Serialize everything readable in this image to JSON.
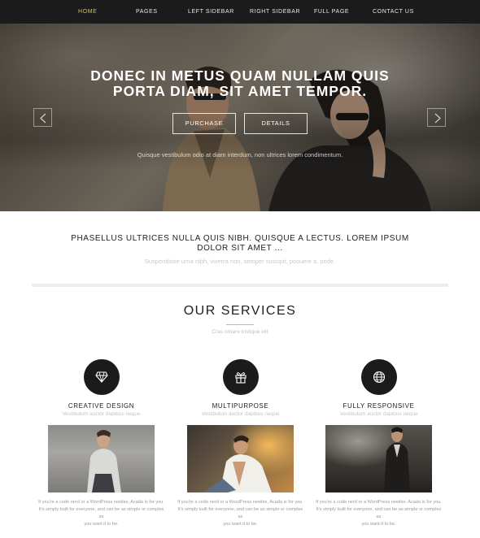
{
  "nav": {
    "items": [
      {
        "label": "HOME",
        "active": true
      },
      {
        "label": "PAGES",
        "active": false
      },
      {
        "label": "LEFT SIDEBAR",
        "active": false
      },
      {
        "label": "RIGHT SIDEBAR",
        "active": false
      },
      {
        "label": "FULL PAGE",
        "active": false
      },
      {
        "label": "CONTACT US",
        "active": false
      }
    ],
    "active_color": "#c9c46a"
  },
  "hero": {
    "title_line1": "DONEC IN METUS QUAM NULLAM QUIS",
    "title_line2": "PORTA DIAM, SIT AMET TEMPOR.",
    "purchase_label": "PURCHASE",
    "details_label": "DETAILS",
    "subtitle": "Quisque vestibulum odio at diam interdum, non ultrices lorem condimentum.",
    "prev_icon": "chevron-left-icon",
    "next_icon": "chevron-right-icon"
  },
  "intro": {
    "title_line1": "PHASELLUS ULTRICES NULLA QUIS NIBH. QUISQUE A LECTUS. LOREM IPSUM",
    "title_line2": "DOLOR SIT AMET ...",
    "subtitle": "Suspendisse urna nibh, viverra non, semper suscipit, posuere a, pede."
  },
  "services": {
    "title": "OUR SERVICES",
    "subtitle": "Cras ornare tristique elit",
    "accent_color": "#c9b98a",
    "items": [
      {
        "icon": "diamond-icon",
        "title": "CREATIVE DESIGN",
        "subtitle": "Vestibulum auctor dapibus neque",
        "text_line1": "If you're a code nerd or a WordPress newbie, Acada is for you.",
        "text_line2": "It's simply built for everyone, and can be as simple or complex as",
        "text_line3": "you want it to be."
      },
      {
        "icon": "gift-icon",
        "title": "MULTIPURPOSE",
        "subtitle": "Vestibulum auctor dapibus neque",
        "text_line1": "If you're a code nerd or a WordPress newbie, Acada is for you.",
        "text_line2": "It's simply built for everyone, and can be as simple or complex as",
        "text_line3": "you want it to be."
      },
      {
        "icon": "globe-icon",
        "title": "FULLY RESPONSIVE",
        "subtitle": "Vestibulum auctor dapibus neque",
        "text_line1": "If you're a code nerd or a WordPress newbie, Acada is for you.",
        "text_line2": "It's simply built for everyone, and can be as simple or complex as",
        "text_line3": "you want it to be."
      }
    ]
  }
}
